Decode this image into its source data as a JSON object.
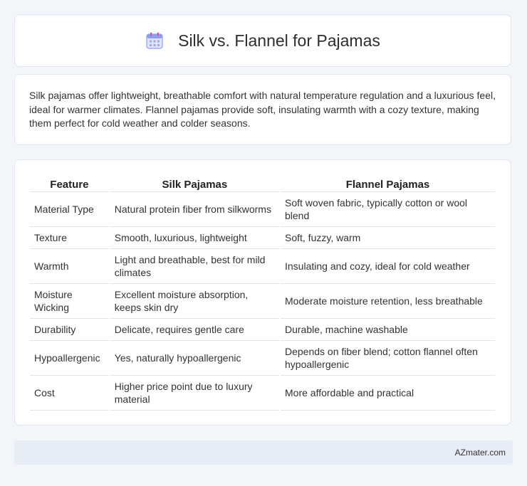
{
  "page": {
    "title": "Silk vs. Flannel for Pajamas",
    "icon": "calendar-icon",
    "intro": "Silk pajamas offer lightweight, breathable comfort with natural temperature regulation and a luxurious feel, ideal for warmer climates. Flannel pajamas provide soft, insulating warmth with a cozy texture, making them perfect for cold weather and colder seasons."
  },
  "table": {
    "headers": [
      "Feature",
      "Silk Pajamas",
      "Flannel Pajamas"
    ],
    "rows": [
      [
        "Material Type",
        "Natural protein fiber from silkworms",
        "Soft woven fabric, typically cotton or wool blend"
      ],
      [
        "Texture",
        "Smooth, luxurious, lightweight",
        "Soft, fuzzy, warm"
      ],
      [
        "Warmth",
        "Light and breathable, best for mild climates",
        "Insulating and cozy, ideal for cold weather"
      ],
      [
        "Moisture Wicking",
        "Excellent moisture absorption, keeps skin dry",
        "Moderate moisture retention, less breathable"
      ],
      [
        "Durability",
        "Delicate, requires gentle care",
        "Durable, machine washable"
      ],
      [
        "Hypoallergenic",
        "Yes, naturally hypoallergenic",
        "Depends on fiber blend; cotton flannel often hypoallergenic"
      ],
      [
        "Cost",
        "Higher price point due to luxury material",
        "More affordable and practical"
      ]
    ]
  },
  "footer": {
    "site": "AZmater.com"
  },
  "colors": {
    "background": "#f2f5fa",
    "card": "#ffffff",
    "footer": "#e7edf7",
    "icon_accent": "#7b8ff0"
  }
}
